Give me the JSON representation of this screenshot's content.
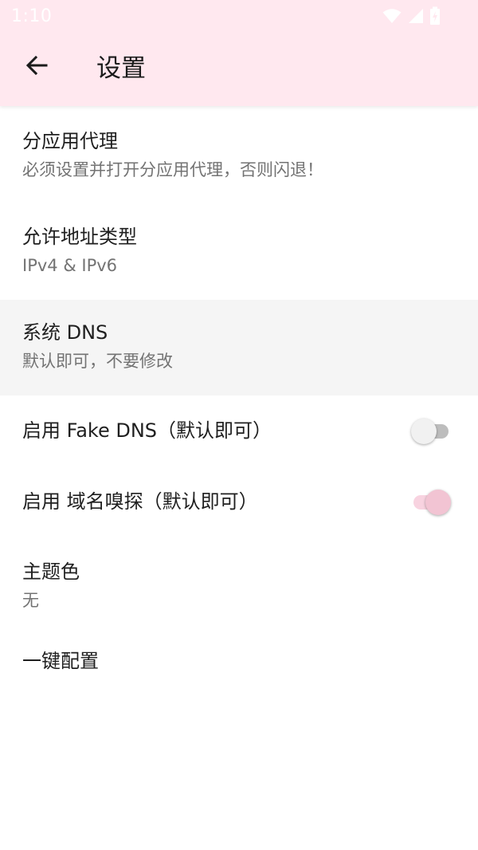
{
  "status_bar": {
    "time": "1:10",
    "icons": [
      "wifi-icon",
      "cellular-signal-icon",
      "battery-charging-icon"
    ]
  },
  "toolbar": {
    "title": "设置",
    "back_icon": "arrow-left-icon"
  },
  "colors": {
    "appbar_background": "#ffe8ef",
    "selected_row_background": "#f5f5f5",
    "switch_on_thumb": "#f2c4d3",
    "switch_on_track": "#f8d3e0",
    "switch_off_thumb": "#f1f1f1",
    "switch_off_track": "#bdbdbd"
  },
  "settings": [
    {
      "title": "分应用代理",
      "summary": "必须设置并打开分应用代理，否则闪退！"
    },
    {
      "title": "允许地址类型",
      "summary": "IPv4 & IPv6"
    },
    {
      "title": "系统 DNS",
      "summary": "默认即可，不要修改"
    },
    {
      "title": "启用 Fake DNS（默认即可）",
      "switch_on": false
    },
    {
      "title": "启用 域名嗅探（默认即可）",
      "switch_on": true
    },
    {
      "title": "主题色",
      "summary": "无"
    },
    {
      "title": "一键配置"
    }
  ]
}
